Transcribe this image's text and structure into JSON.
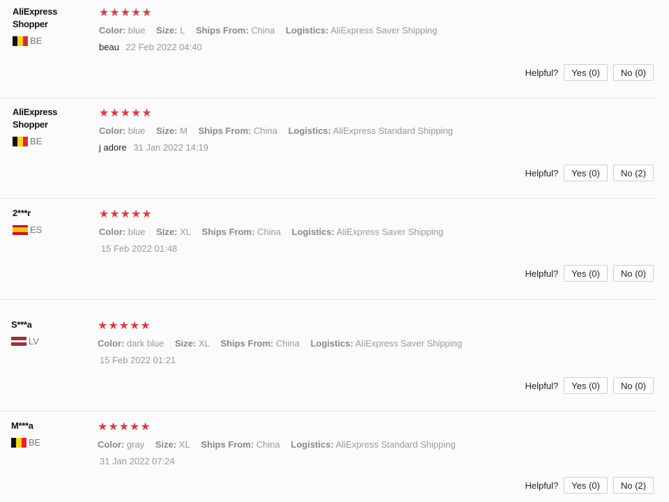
{
  "colors": {
    "star": "#e2383f",
    "muted": "#999999",
    "divider": "#e6e6e6"
  },
  "icons": {
    "star": "star-icon",
    "flag": "country-flag-icon"
  },
  "labels": {
    "color": "Color:",
    "size": "Size:",
    "ships_from": "Ships From:",
    "logistics": "Logistics:",
    "helpful": "Helpful?"
  },
  "reviews": [
    {
      "user": "AliExpress Shopper",
      "country": "BE",
      "stars": "★★★★★",
      "color": "blue",
      "size": "L",
      "ships_from": "China",
      "logistics": "AliExpress Saver Shipping",
      "text": "beau",
      "date": "22 Feb 2022 04:40",
      "yes": "Yes (0)",
      "no": "No (0)"
    },
    {
      "user": "AliExpress Shopper",
      "country": "BE",
      "stars": "★★★★★",
      "color": "blue",
      "size": "M",
      "ships_from": "China",
      "logistics": "AliExpress Standard Shipping",
      "text": "j adore",
      "date": "31 Jan 2022 14:19",
      "yes": "Yes (0)",
      "no": "No (2)"
    },
    {
      "user": "2***r",
      "country": "ES",
      "stars": "★★★★★",
      "color": "blue",
      "size": "XL",
      "ships_from": "China",
      "logistics": "AliExpress Saver Shipping",
      "text": "",
      "date": "15 Feb 2022 01:48",
      "yes": "Yes (0)",
      "no": "No (0)"
    },
    {
      "user": "S***a",
      "country": "LV",
      "stars": "★★★★★",
      "color": "dark blue",
      "size": "XL",
      "ships_from": "China",
      "logistics": "AliExpress Saver Shipping",
      "text": "",
      "date": "15 Feb 2022 01:21",
      "yes": "Yes (0)",
      "no": "No (0)"
    },
    {
      "user": "M***a",
      "country": "BE",
      "stars": "★★★★★",
      "color": "gray",
      "size": "XL",
      "ships_from": "China",
      "logistics": "AliExpress Standard Shipping",
      "text": "",
      "date": "31 Jan 2022 07:24",
      "yes": "Yes (0)",
      "no": "No (2)"
    }
  ]
}
